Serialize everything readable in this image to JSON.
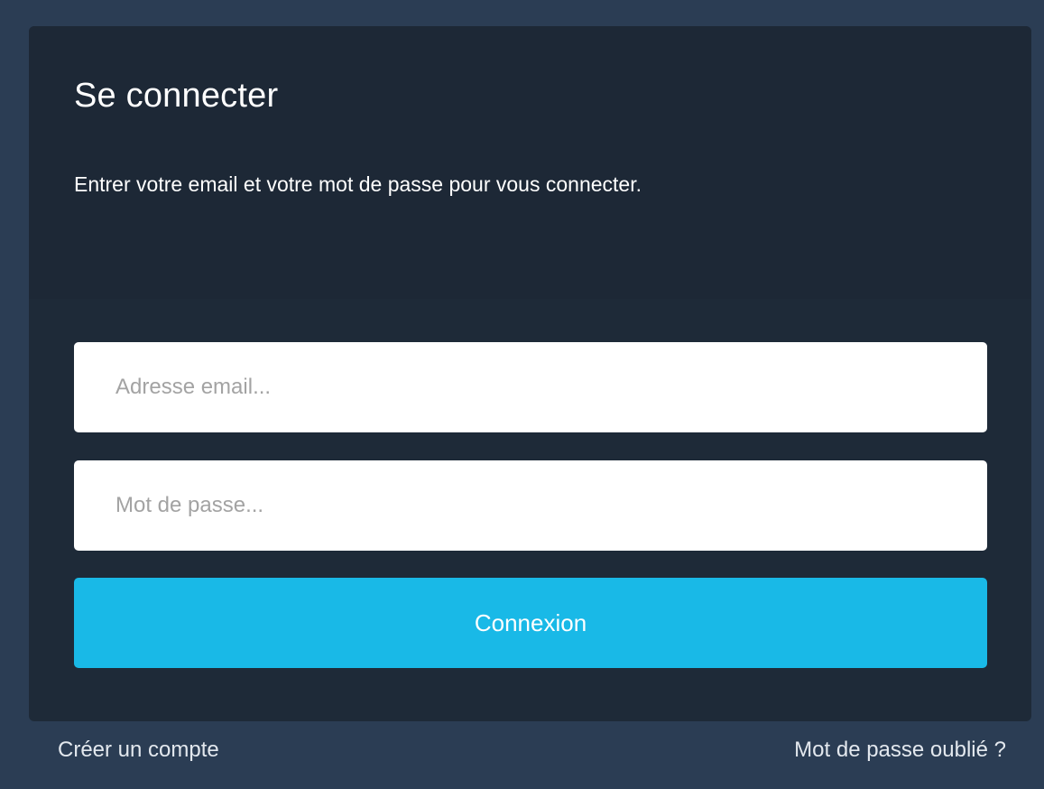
{
  "login": {
    "title": "Se connecter",
    "subtitle": "Entrer votre email et votre mot de passe pour vous connecter.",
    "email_placeholder": "Adresse email...",
    "email_value": "",
    "password_placeholder": "Mot de passe...",
    "password_value": "",
    "submit_label": "Connexion"
  },
  "footer": {
    "create_account": "Créer un compte",
    "forgot_password": "Mot de passe oublié ?"
  },
  "colors": {
    "page_background": "#2b3d54",
    "card_background": "#1e2a38",
    "button_accent": "#19b9e7"
  }
}
